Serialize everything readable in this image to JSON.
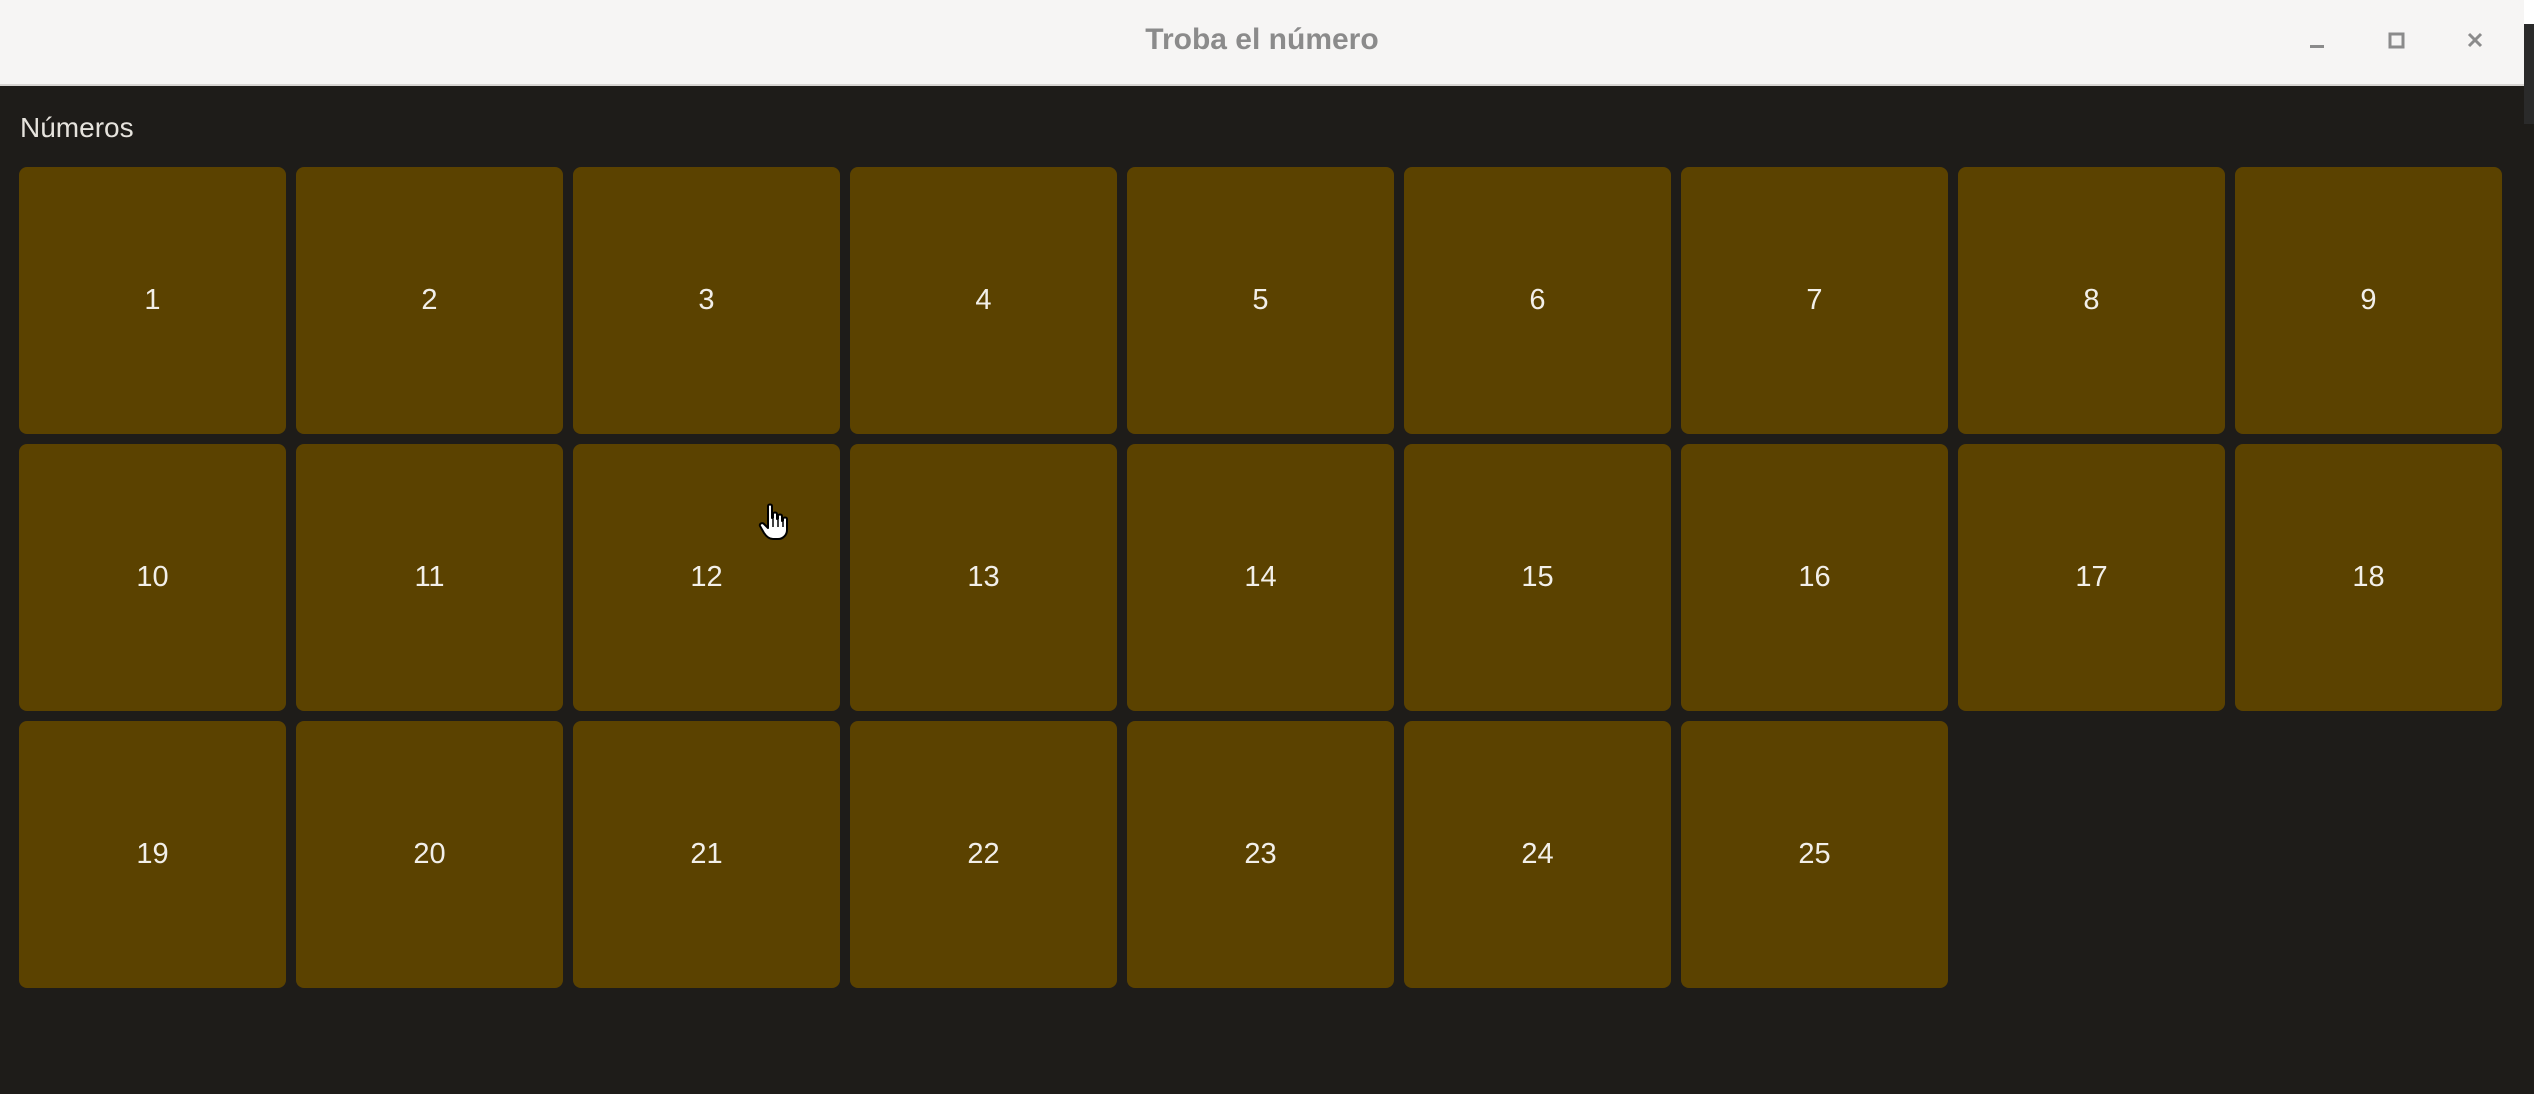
{
  "window": {
    "title": "Troba el número"
  },
  "section": {
    "label": "Números"
  },
  "numbers": [
    "1",
    "2",
    "3",
    "4",
    "5",
    "6",
    "7",
    "8",
    "9",
    "10",
    "11",
    "12",
    "13",
    "14",
    "15",
    "16",
    "17",
    "18",
    "19",
    "20",
    "21",
    "22",
    "23",
    "24",
    "25"
  ],
  "colors": {
    "button_bg": "#5b4200",
    "window_bg": "#1e1c19",
    "titlebar_bg": "#f6f5f4",
    "title_text": "#8b8b8b"
  },
  "icons": {
    "minimize": "minimize-icon",
    "maximize": "maximize-icon",
    "close": "close-icon",
    "cursor": "hand-pointer-cursor-icon"
  }
}
